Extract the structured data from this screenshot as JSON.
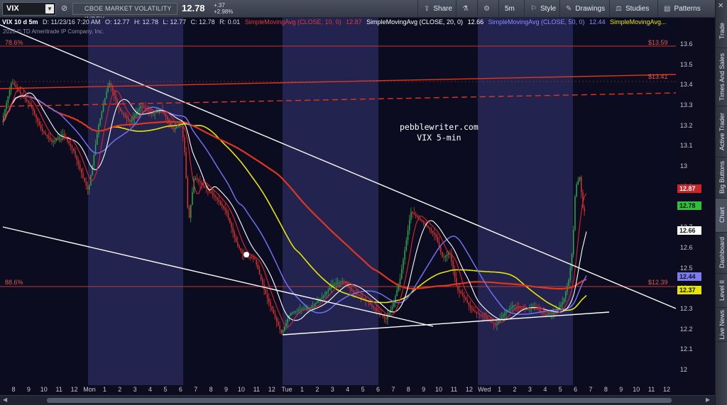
{
  "toolbar": {
    "symbol": "VIX",
    "description": "CBOE MARKET VOLATILITY INDEX",
    "last": "12.78",
    "change": "+.37",
    "change_pct": "+2.98%",
    "share": "Share",
    "interval": "5m",
    "style": "Style",
    "drawings": "Drawings",
    "studies": "Studies",
    "patterns": "Patterns"
  },
  "info": {
    "title": "VIX 10 d 5m",
    "date": "D: 11/23/16 7:20 AM",
    "open": "O: 12.77",
    "high": "H: 12.78",
    "low": "L: 12.77",
    "close": "C: 12.78",
    "range": "R: 0.01",
    "sma10": "SimpleMovingAvg (CLOSE, 10, 0)",
    "sma10_val": "12.87",
    "sma20": "SimpleMovingAvg (CLOSE, 20, 0)",
    "sma20_val": "12.66",
    "sma50": "SimpleMovingAvg (CLOSE, 50, 0)",
    "sma50_val": "12.44",
    "sma_more": "SimpleMovingAvg...",
    "copyright": "2016 © TD Ameritrade IP Company, Inc."
  },
  "fib": {
    "top_pct": "78.6%",
    "top_val": "$13.59",
    "mid_val": "$13.41",
    "low_pct": "88.6%",
    "low_val": "$12.39"
  },
  "watermark": {
    "line1": "pebblewriter.com",
    "line2": "VIX 5-min"
  },
  "price_axis": [
    "13.6",
    "13.5",
    "13.4",
    "13.3",
    "13.2",
    "13.1",
    "13",
    "12.9",
    "12.8",
    "12.7",
    "12.6",
    "12.5",
    "12.4",
    "12.3",
    "12.2",
    "12.1",
    "12"
  ],
  "tags": {
    "sma10": "12.87",
    "last": "12.78",
    "sma20": "12.66",
    "sma50": "12.44",
    "sma200": "12.37"
  },
  "time_axis": [
    "8",
    "9",
    "10",
    "11",
    "12",
    "Mon",
    "1",
    "2",
    "3",
    "4",
    "5",
    "6",
    "7",
    "8",
    "9",
    "10",
    "11",
    "12",
    "Tue",
    "1",
    "2",
    "3",
    "4",
    "5",
    "6",
    "7",
    "8",
    "9",
    "10",
    "11",
    "12",
    "Wed",
    "1",
    "2",
    "3",
    "4",
    "5",
    "6",
    "7",
    "8",
    "9",
    "10",
    "11",
    "12"
  ],
  "sidebar": [
    "Trade",
    "Times And Sales",
    "Active Trader",
    "Big Buttons",
    "Chart",
    "Dashboard",
    "Level II",
    "Live News"
  ],
  "colors": {
    "background": "#0c0c20",
    "session": "#232350",
    "sma10": "#d8262a",
    "sma20": "#ffffff",
    "sma50": "#6f6ff0",
    "sma_yellow": "#e6e600",
    "sma_red": "#e0361d",
    "up": "#2ea84a",
    "down": "#d9352b"
  }
}
